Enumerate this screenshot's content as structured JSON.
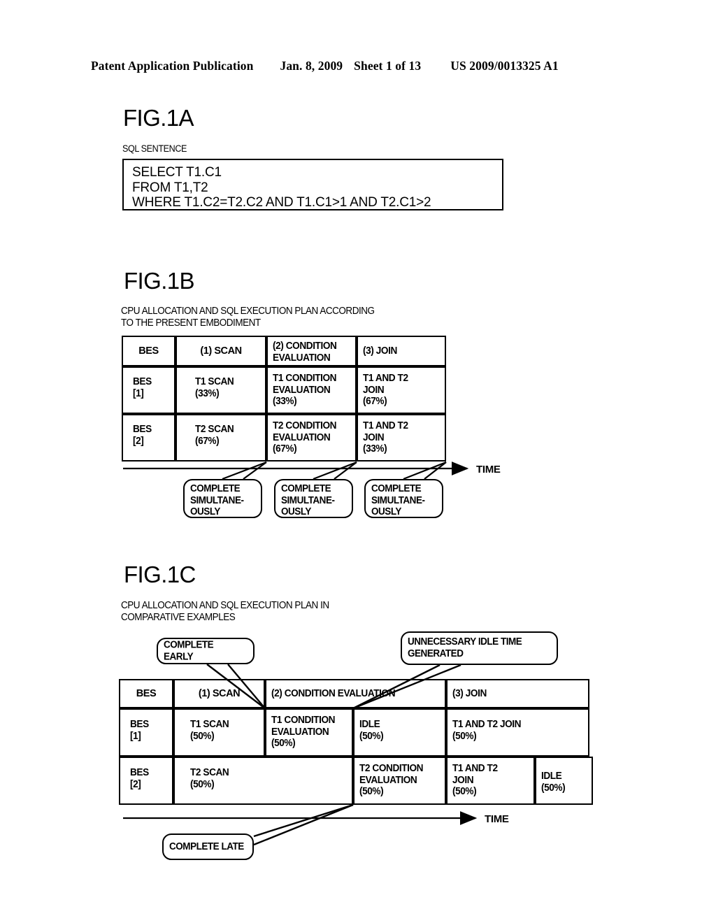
{
  "header": {
    "publication": "Patent Application Publication",
    "date": "Jan. 8, 2009",
    "sheet": "Sheet 1 of 13",
    "number": "US 2009/0013325 A1"
  },
  "fig1a": {
    "title": "FIG.1A",
    "label": "SQL SENTENCE",
    "sql": "SELECT T1.C1\nFROM T1,T2\nWHERE T1.C2=T2.C2 AND T1.C1>1 AND T2.C1>2"
  },
  "fig1b": {
    "title": "FIG.1B",
    "caption": "CPU ALLOCATION AND SQL EXECUTION PLAN ACCORDING\nTO THE PRESENT EMBODIMENT",
    "header_row": {
      "col0": "BES",
      "col1": "(1) SCAN",
      "col2": "(2) CONDITION\n    EVALUATION",
      "col3": "(3) JOIN"
    },
    "rows": [
      {
        "bes": "BES\n[1]",
        "scan": "T1 SCAN\n(33%)",
        "condition": "T1 CONDITION\nEVALUATION\n(33%)",
        "join": "T1 AND T2\nJOIN\n(67%)"
      },
      {
        "bes": "BES\n[2]",
        "scan": "T2 SCAN\n(67%)",
        "condition": "T2 CONDITION\nEVALUATION\n(67%)",
        "join": "T1 AND T2\nJOIN\n(33%)"
      }
    ],
    "time_label": "TIME",
    "callouts": [
      {
        "text": "COMPLETE\nSIMULTANE-\nOUSLY"
      },
      {
        "text": "COMPLETE\nSIMULTANE-\nOUSLY"
      },
      {
        "text": "COMPLETE\nSIMULTANE-\nOUSLY"
      }
    ]
  },
  "fig1c": {
    "title": "FIG.1C",
    "caption": "CPU ALLOCATION AND SQL EXECUTION PLAN IN\nCOMPARATIVE EXAMPLES",
    "callout_early": "COMPLETE EARLY",
    "callout_idle": "UNNECESSARY IDLE TIME\nGENERATED",
    "callout_late": "COMPLETE LATE",
    "header_row": {
      "col0": "BES",
      "col1": "(1) SCAN",
      "col2": "(2) CONDITION EVALUATION",
      "col3": "(3) JOIN"
    },
    "row1": {
      "bes": "BES\n[1]",
      "scan": "T1 SCAN\n(50%)",
      "condition": "T1 CONDITION\nEVALUATION\n(50%)",
      "idle": "IDLE\n(50%)",
      "join": "T1 AND T2 JOIN\n(50%)"
    },
    "row2": {
      "bes": "BES\n[2]",
      "scan": "T2 SCAN\n(50%)",
      "condition": "T2 CONDITION\nEVALUATION\n(50%)",
      "join": "T1 AND T2\nJOIN\n(50%)",
      "idle": "IDLE\n(50%)"
    },
    "time_label": "TIME"
  }
}
